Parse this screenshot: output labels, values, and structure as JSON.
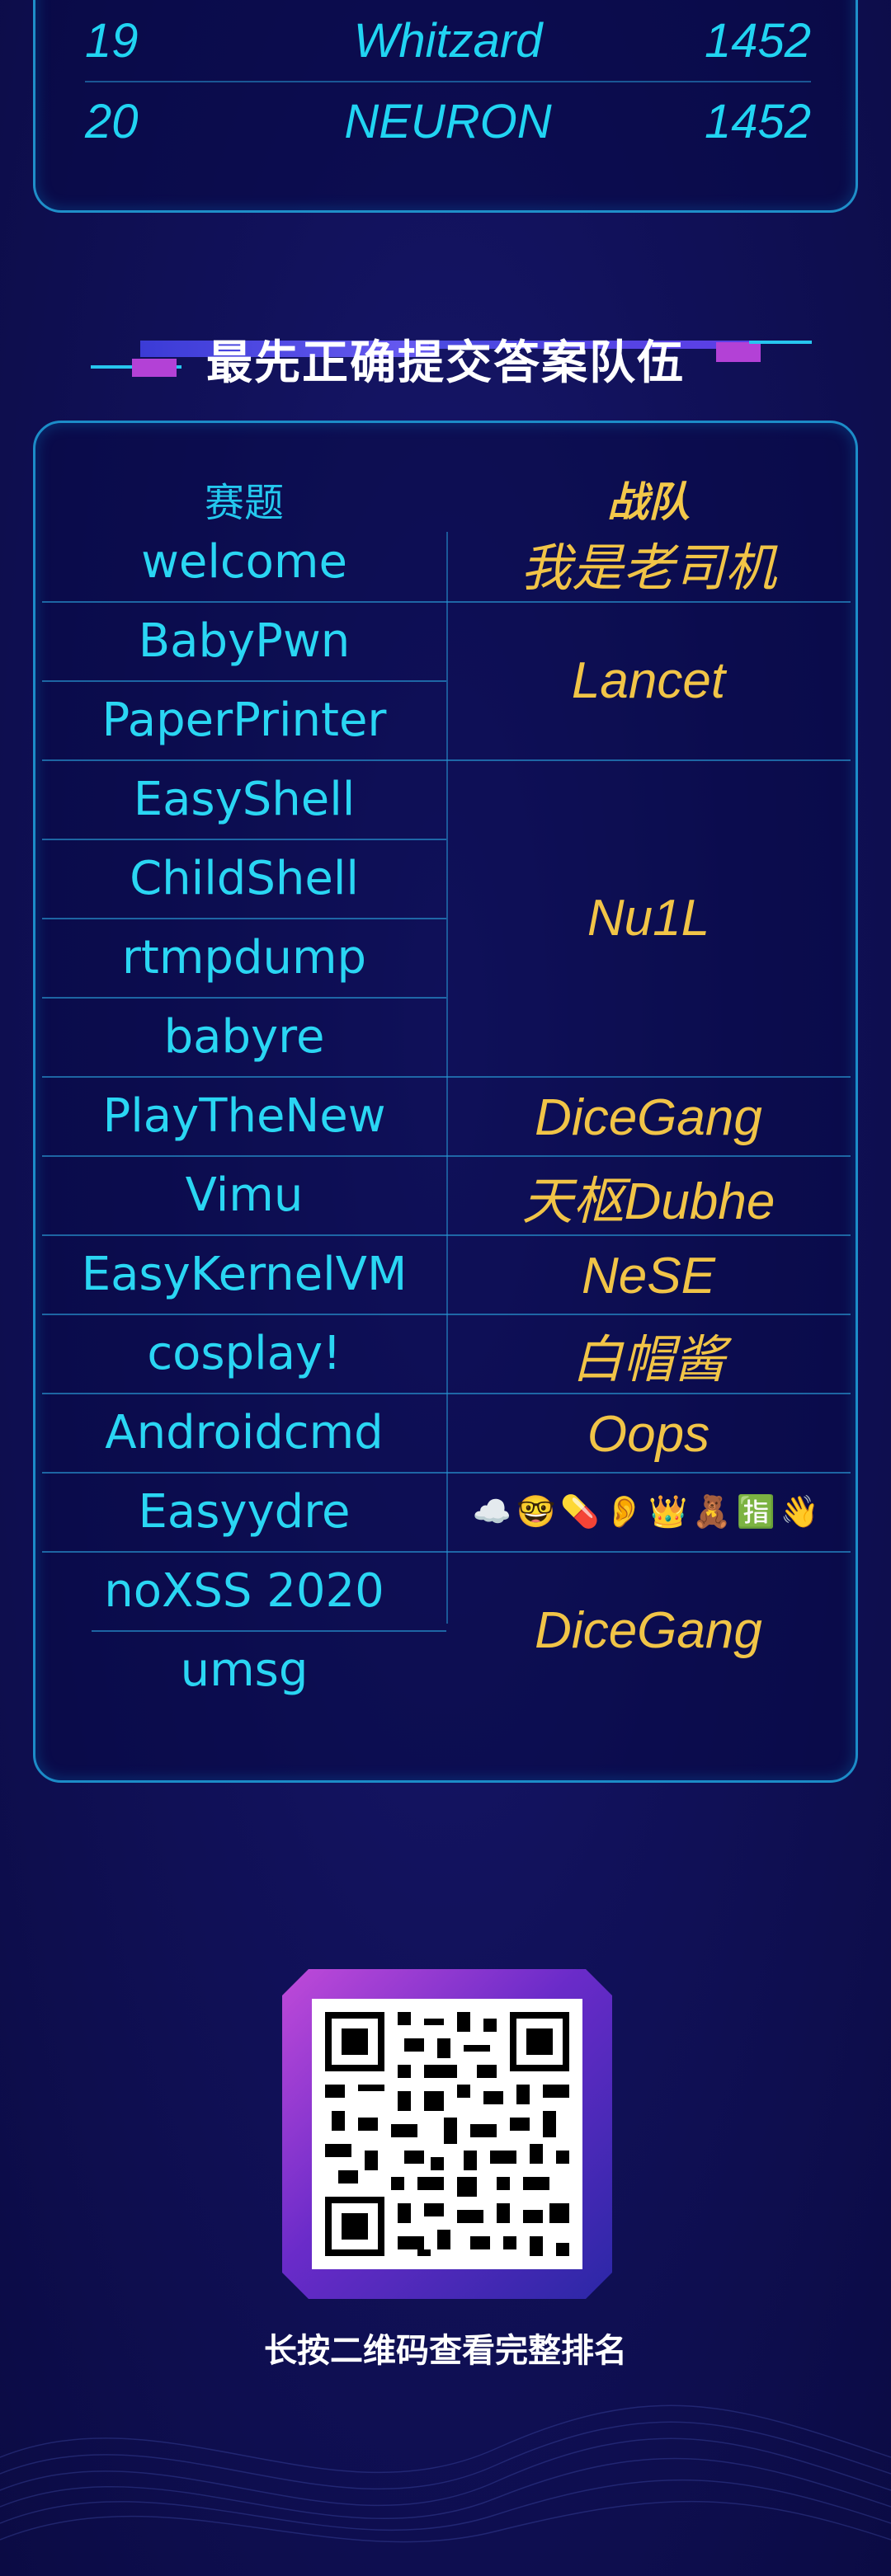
{
  "leaderboard_tail": [
    {
      "rank": "19",
      "name": "Whitzard",
      "score": "1452"
    },
    {
      "rank": "20",
      "name": "NEURON",
      "score": "1452"
    }
  ],
  "section_title": "最先正确提交答案队伍",
  "table": {
    "header": {
      "challenge": "赛题",
      "team": "战队"
    },
    "challenges": [
      "welcome",
      "BabyPwn",
      "PaperPrinter",
      "EasyShell",
      "ChildShell",
      "rtmpdump",
      "babyre",
      "PlayTheNew",
      "Vimu",
      "EasyKernelVM",
      "cosplay!",
      "Androidcmd",
      "Easyydre",
      "noXSS 2020",
      "umsg"
    ],
    "teams": [
      "我是老司机",
      "Lancet",
      "Nu1L",
      "DiceGang",
      "天枢Dubhe",
      "NeSE",
      "白帽酱",
      "Oops",
      "☁️🤓💊👂👑🧸🈯👋",
      "DiceGang"
    ]
  },
  "qr": {
    "caption": "长按二维码查看完整排名"
  },
  "colors": {
    "accent_cyan": "#21d4f2",
    "accent_gold": "#f1c447",
    "background": "#11115a"
  }
}
